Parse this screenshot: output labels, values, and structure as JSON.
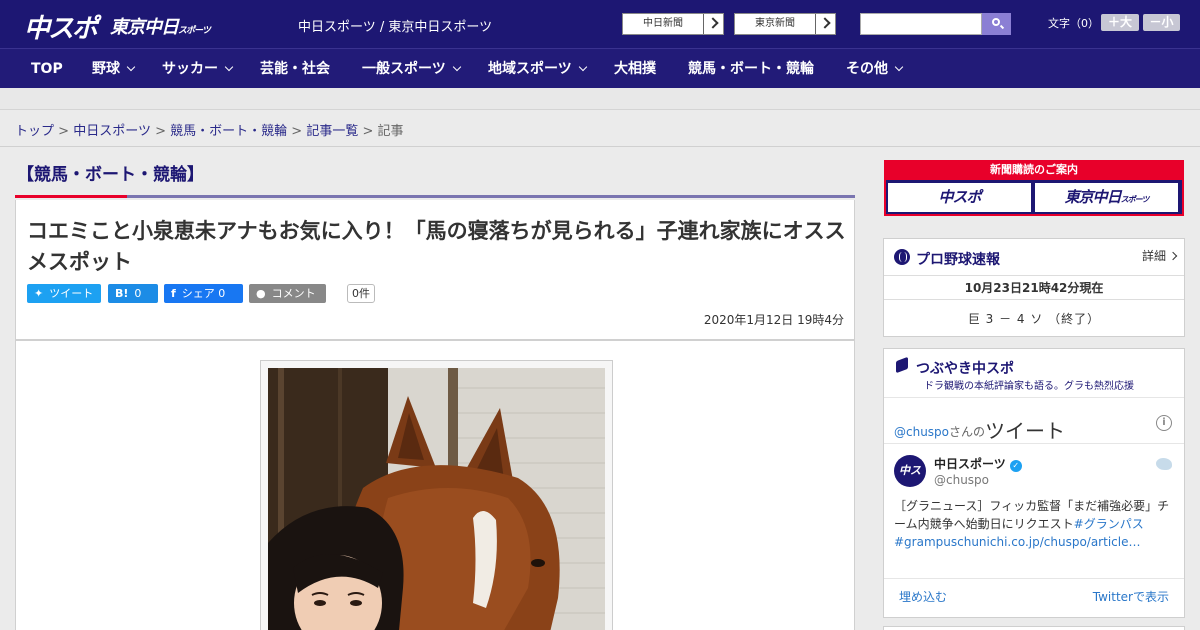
{
  "header": {
    "logo_main": "中スポ",
    "logo_tokyo": "東京中日",
    "logo_tokyo_small": "スポーツ",
    "site_names": "中日スポーツ / 東京中日スポーツ",
    "link_chunichi": "中日新聞",
    "link_tokyo": "東京新聞",
    "search_placeholder": "",
    "font_size_label": "文字（0）",
    "font_larger": "＋大",
    "font_smaller": "－小"
  },
  "nav": {
    "items": [
      {
        "label": "TOP"
      },
      {
        "label": "野球"
      },
      {
        "label": "サッカー"
      },
      {
        "label": "芸能・社会"
      },
      {
        "label": "一般スポーツ"
      },
      {
        "label": "地域スポーツ"
      },
      {
        "label": "大相撲"
      },
      {
        "label": "競馬・ボート・競輪"
      },
      {
        "label": "その他"
      }
    ]
  },
  "breadcrumb": {
    "items": [
      "トップ",
      "中日スポーツ",
      "競馬・ボート・競輪",
      "記事一覧",
      "記事"
    ],
    "separator": ">"
  },
  "section": {
    "title": "【競馬・ボート・競輪】"
  },
  "article": {
    "headline": "コエミこと小泉恵未アナもお気に入り！「馬の寝落ちが見られる」子連れ家族にオススメスポット",
    "date": "2020年1月12日 19時4分",
    "share": {
      "tweet": "ツイート",
      "hatena_icon": "B!",
      "hatena_count": "0",
      "facebook": "シェア",
      "facebook_count": "0",
      "comment": "コメント",
      "comment_count": "0件"
    }
  },
  "sidebar": {
    "subscription": {
      "caption": "新聞購読のご案内",
      "left": "中スポ",
      "right": "東京中日",
      "right_small": "スポーツ"
    },
    "baseball": {
      "title": "プロ野球速報",
      "detail": "詳細",
      "timestamp": "10月23日21時42分現在",
      "score": "巨 3 － 4 ソ （終了）"
    },
    "tweets": {
      "title": "つぶやき中スポ",
      "subtitle": "ドラ観戦の本紙評論家も語る。グラも熱烈応援",
      "handle_at": "@chuspo",
      "handle_mid": "さんの",
      "handle_big": "ツイート",
      "info": "i",
      "avatar_text": "中スポ",
      "user_name": "中日スポーツ",
      "user_handle": "@chuspo",
      "text_plain": "［グラニュース］フィッカ監督「まだ補強必要」チーム内競争へ始動日にリクエスト",
      "text_tag": "#グランパス",
      "text_link": "#grampuschunichi.co.jp/chuspo/article…",
      "embed": "埋め込む",
      "view_on": "Twitterで表示"
    }
  },
  "colors": {
    "brand_navy": "#1d1773",
    "accent_red": "#e8002a",
    "twitter_blue": "#1da1f2",
    "facebook_blue": "#1877f2"
  }
}
